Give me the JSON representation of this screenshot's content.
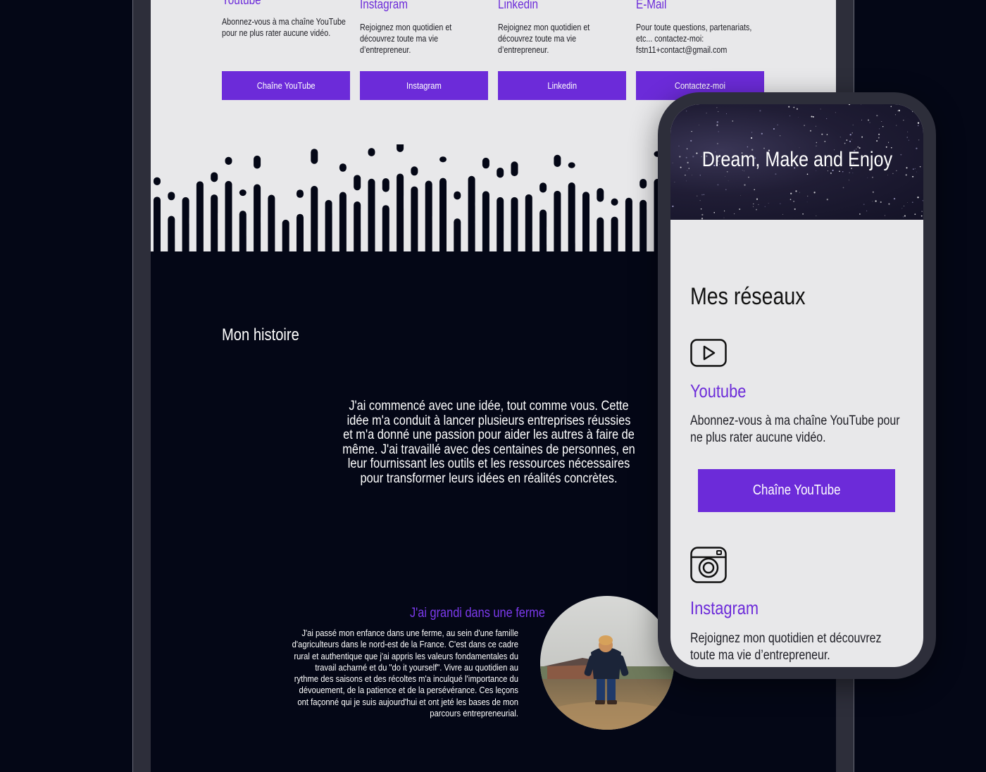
{
  "colors": {
    "accent": "#6c2bd9",
    "page_background": "#040716",
    "band_background": "#e8e8ea",
    "device_frame": "#2d2e3a"
  },
  "desktop": {
    "networks": [
      {
        "title": "Youtube",
        "description": "Abonnez-vous à ma chaîne YouTube pour ne plus rater aucune vidéo.",
        "button": "Chaîne YouTube"
      },
      {
        "title": "Instagram",
        "description": "Rejoignez mon quotidien et découvrez toute ma vie d’entrepreneur.",
        "button": "Instagram"
      },
      {
        "title": "Linkedin",
        "description": "Rejoignez mon quotidien et découvrez toute ma vie d’entrepreneur.",
        "button": "Linkedin"
      },
      {
        "title": "E-Mail",
        "description": "Pour toute questions, partenariats, etc... contactez-moi: fstn11+contact@gmail.com",
        "button": "Contactez-moi"
      }
    ],
    "story": {
      "title": "Mon histoire",
      "text": "J'ai commencé avec une idée, tout comme vous. Cette idée m'a conduit à lancer plusieurs entreprises réussies et m'a donné une passion pour aider les autres à faire de même. J'ai travaillé avec des centaines de personnes, en leur fournissant les outils et les ressources nécessaires pour transformer leurs idées en réalités concrètes.",
      "farm_title": "J'ai grandi dans une ferme",
      "farm_text": "J'ai passé mon enfance dans une ferme, au sein d'une famille d'agriculteurs dans le nord-est de la France. C'est dans ce cadre rural et authentique que j'ai appris les valeurs fondamentales du travail acharné et du \"do it yourself\". Vivre au quotidien au rythme des saisons et des récoltes m'a inculqué l'importance du dévouement, de la patience et de la persévérance. Ces leçons ont façonné qui je suis aujourd'hui et ont jeté les bases de mon parcours entrepreneurial."
    }
  },
  "phone": {
    "hero_title": "Dream, Make and Enjoy",
    "section_title": "Mes réseaux",
    "networks": [
      {
        "icon": "youtube-play-icon",
        "title": "Youtube",
        "description": "Abonnez-vous à ma chaîne YouTube pour ne plus rater aucune vidéo.",
        "button": "Chaîne YouTube"
      },
      {
        "icon": "instagram-camera-icon",
        "title": "Instagram",
        "description": "Rejoignez mon quotidien et découvrez toute ma vie d’entrepreneur."
      }
    ]
  }
}
